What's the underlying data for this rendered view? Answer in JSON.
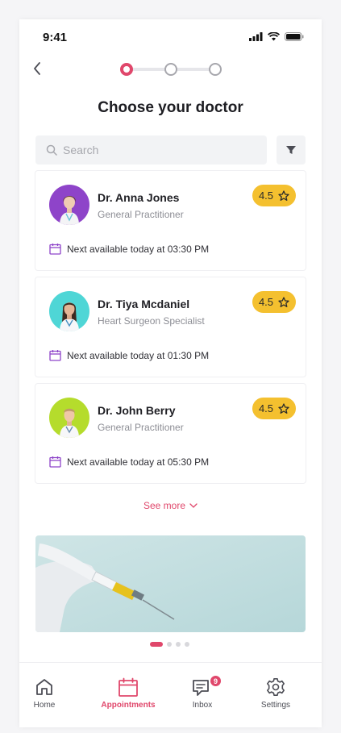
{
  "status_bar": {
    "time": "9:41"
  },
  "header": {
    "title": "Choose your doctor",
    "steps": 3,
    "current_step": 1
  },
  "search": {
    "placeholder": "Search"
  },
  "doctors": [
    {
      "name": "Dr. Anna Jones",
      "specialty": "General Practitioner",
      "rating": "4.5",
      "availability": "Next available today at 03:30 PM",
      "avatar_bg": "#8e44c9"
    },
    {
      "name": "Dr. Tiya Mcdaniel",
      "specialty": "Heart Surgeon Specialist",
      "rating": "4.5",
      "availability": "Next available today at 01:30 PM",
      "avatar_bg": "#4fd6d6"
    },
    {
      "name": "Dr. John Berry",
      "specialty": "General Practitioner",
      "rating": "4.5",
      "availability": "Next available today at 05:30 PM",
      "avatar_bg": "#b5dc2c"
    }
  ],
  "see_more": "See more",
  "carousel": {
    "pages": 4,
    "active": 0
  },
  "tabs": [
    {
      "label": "Home",
      "icon": "home-icon"
    },
    {
      "label": "Appointments",
      "icon": "calendar-icon",
      "active": true
    },
    {
      "label": "Inbox",
      "icon": "chat-icon",
      "badge": "9"
    },
    {
      "label": "Settings",
      "icon": "gear-icon"
    }
  ],
  "colors": {
    "accent": "#e0476b",
    "rating": "#f4c02f",
    "calendar": "#8e44c9"
  }
}
